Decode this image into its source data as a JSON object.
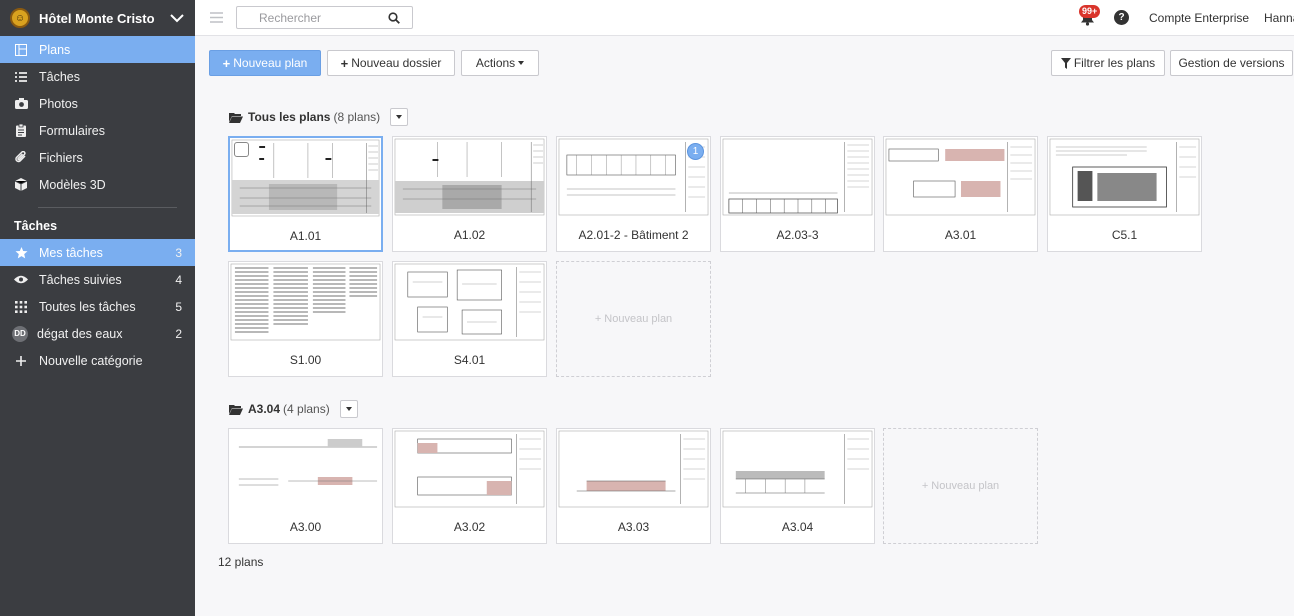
{
  "project": {
    "name": "Hôtel Monte Cristo"
  },
  "sidebar": {
    "nav": [
      {
        "label": "Plans",
        "icon": "plans-icon"
      },
      {
        "label": "Tâches",
        "icon": "list-icon"
      },
      {
        "label": "Photos",
        "icon": "camera-icon"
      },
      {
        "label": "Formulaires",
        "icon": "clipboard-icon"
      },
      {
        "label": "Fichiers",
        "icon": "paperclip-icon"
      },
      {
        "label": "Modèles 3D",
        "icon": "cube-icon"
      }
    ],
    "tasks_heading": "Tâches",
    "task_items": [
      {
        "label": "Mes tâches",
        "count": "3",
        "icon": "star-icon"
      },
      {
        "label": "Tâches suivies",
        "count": "4",
        "icon": "eye-icon"
      },
      {
        "label": "Toutes les tâches",
        "count": "5",
        "icon": "grid-icon"
      },
      {
        "label": "dégat des eaux",
        "count": "2",
        "badge": "DD"
      },
      {
        "label": "Nouvelle catégorie",
        "icon": "plus-icon"
      }
    ]
  },
  "topbar": {
    "search_placeholder": "Rechercher",
    "notification_count": "99+",
    "help": "?",
    "account": "Compte Enterprise",
    "user": "Hanna"
  },
  "toolbar": {
    "new_plan": "Nouveau plan",
    "new_folder": "Nouveau dossier",
    "actions": "Actions",
    "filter": "Filtrer les plans",
    "versions": "Gestion de versions"
  },
  "folders": [
    {
      "name": "Tous les plans",
      "count": "(8 plans)",
      "plans": [
        {
          "label": "A1.01"
        },
        {
          "label": "A1.02"
        },
        {
          "label": "A2.01-2 - Bâtiment 2",
          "badge": "1"
        },
        {
          "label": "A2.03-3"
        },
        {
          "label": "A3.01"
        },
        {
          "label": "C5.1"
        },
        {
          "label": "S1.00"
        },
        {
          "label": "S4.01"
        }
      ],
      "new_plan": "+ Nouveau plan"
    },
    {
      "name": "A3.04",
      "count": "(4 plans)",
      "plans": [
        {
          "label": "A3.00"
        },
        {
          "label": "A3.02"
        },
        {
          "label": "A3.03"
        },
        {
          "label": "A3.04"
        }
      ],
      "new_plan": "+ Nouveau plan"
    }
  ],
  "footer": {
    "count": "12 plans"
  },
  "colors": {
    "accent": "#7aaef0",
    "sidebar": "#3b3d41",
    "notification": "#d9342b"
  }
}
